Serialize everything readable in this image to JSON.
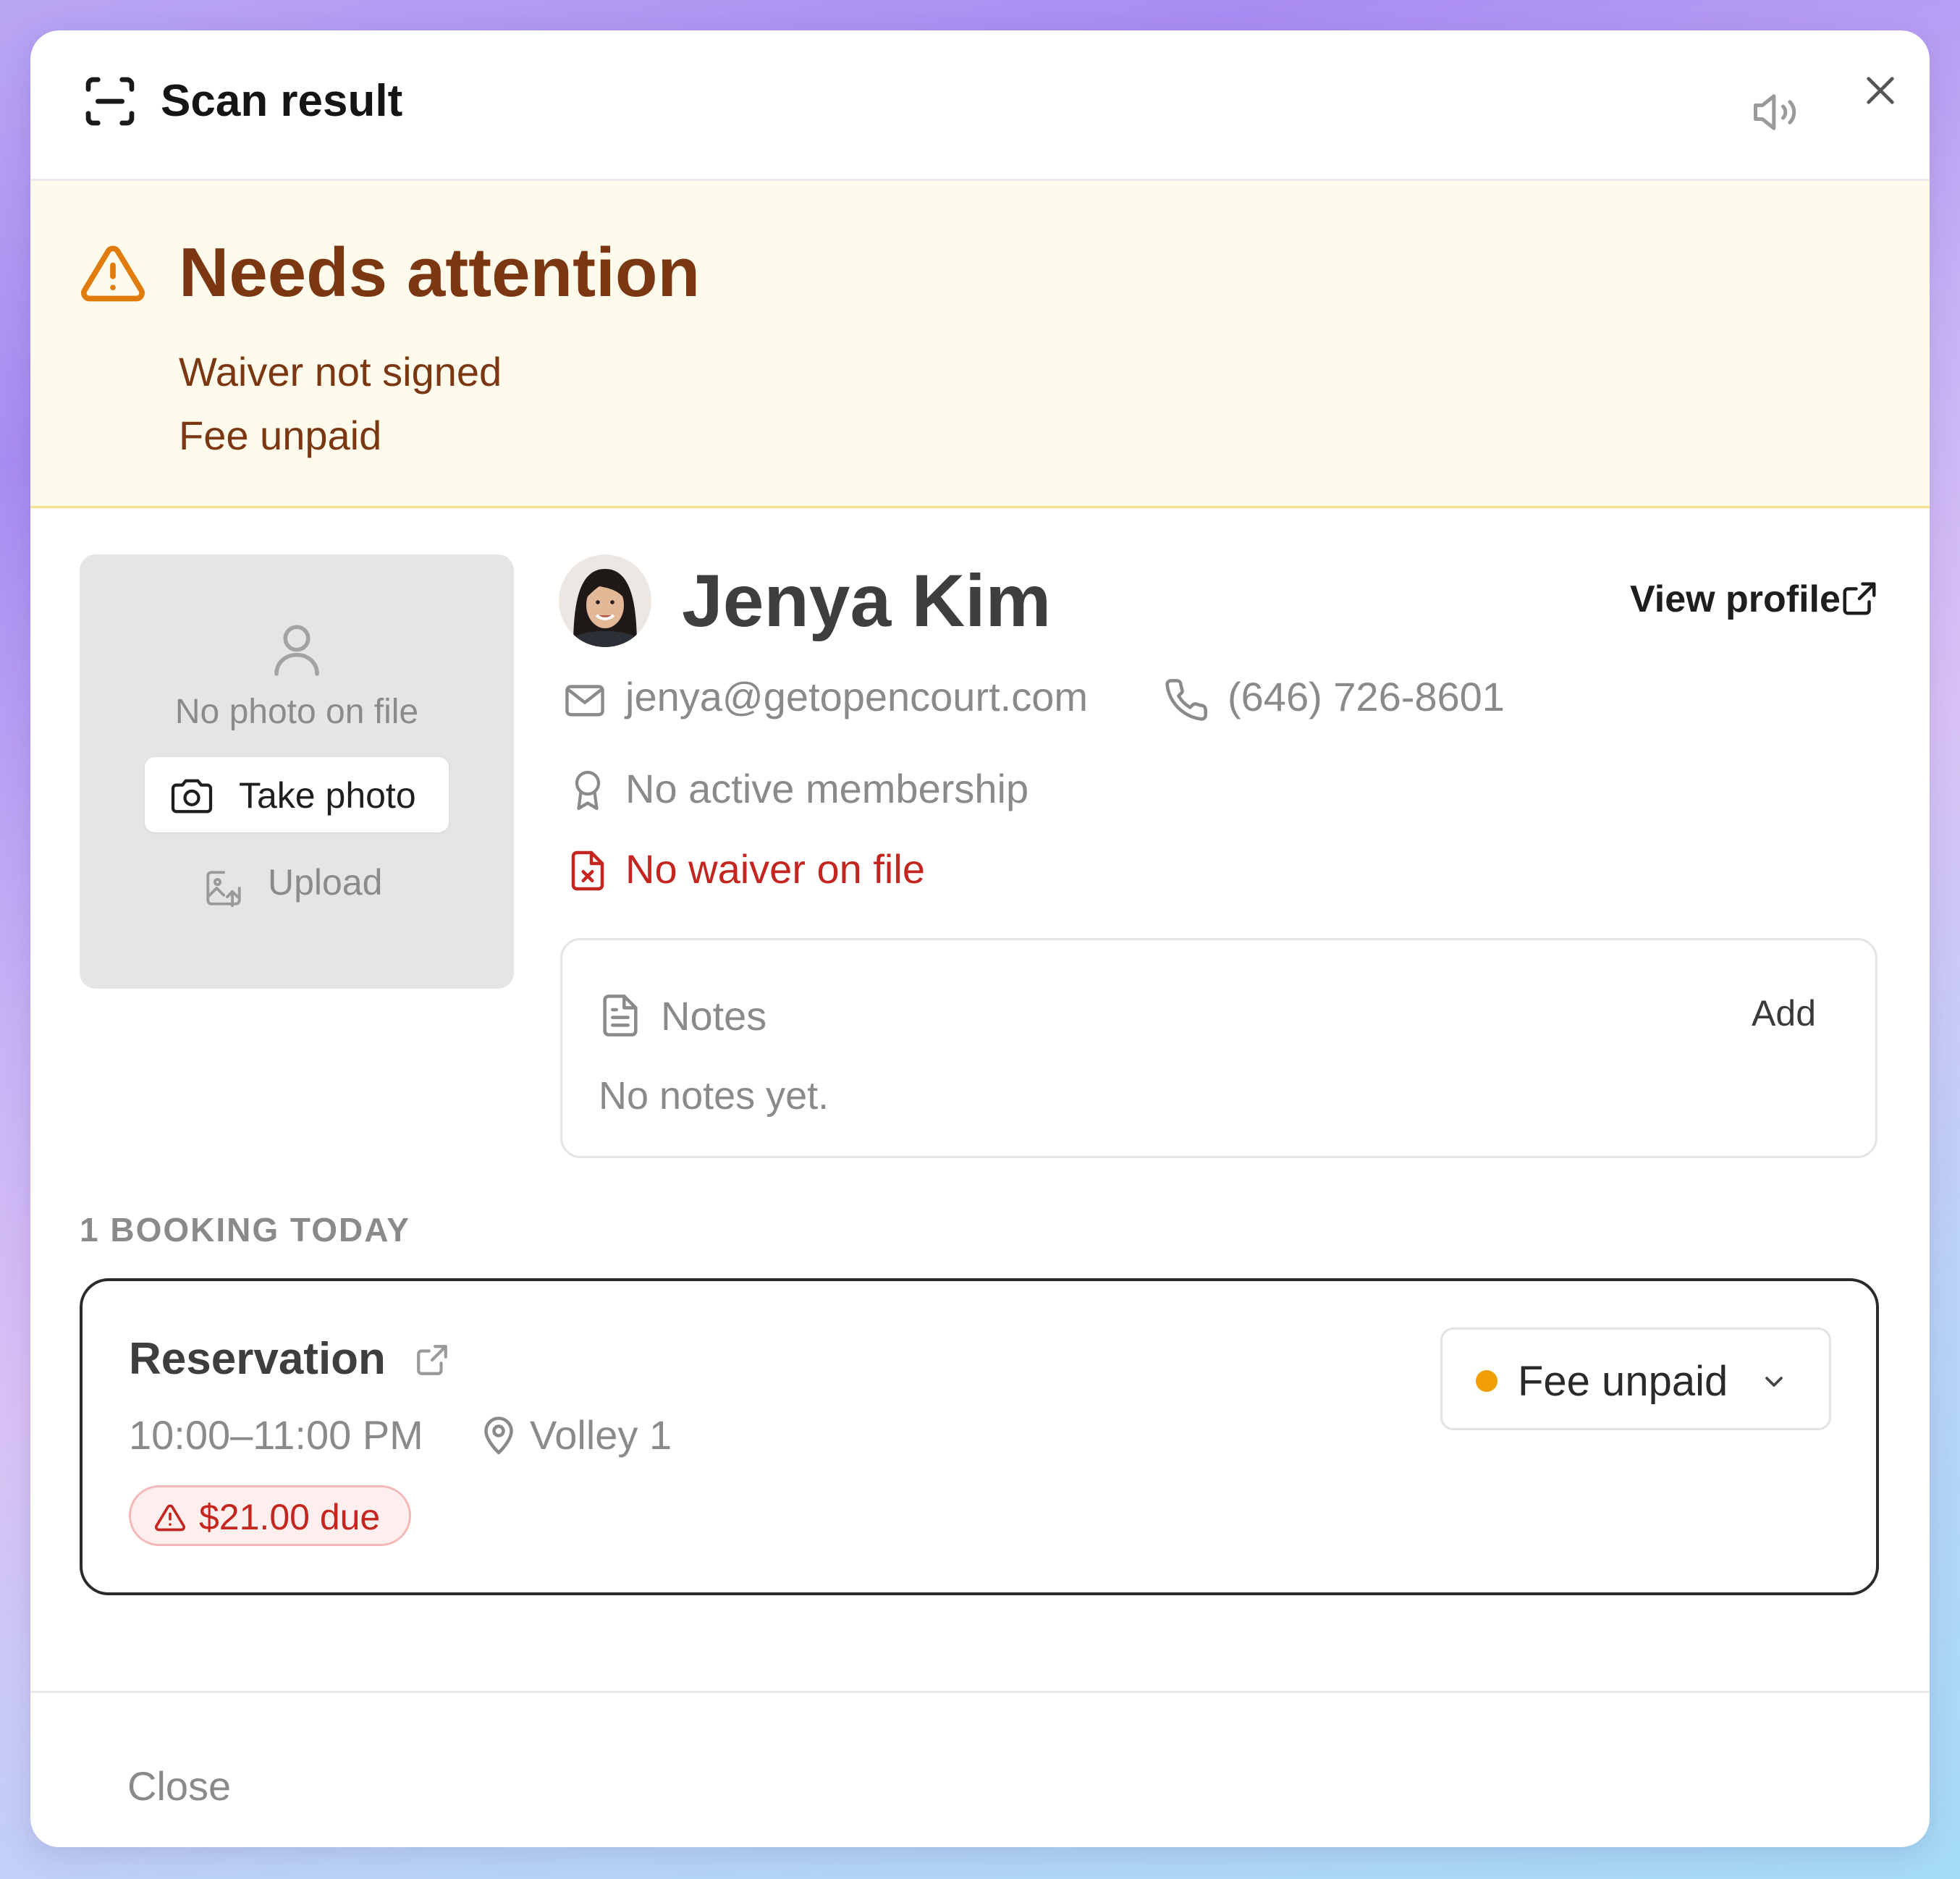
{
  "header": {
    "title": "Scan result",
    "icons": {
      "scan": "scan-frame-icon",
      "sound": "speaker-icon",
      "close": "close-icon"
    }
  },
  "alert": {
    "title": "Needs attention",
    "items": [
      "Waiver not signed",
      "Fee unpaid"
    ],
    "icon": "warning-triangle-icon",
    "color": "#7a3712",
    "background": "#fefbec"
  },
  "photo": {
    "empty_label": "No photo on file",
    "take_photo_label": "Take photo",
    "upload_label": "Upload"
  },
  "profile": {
    "name": "Jenya Kim",
    "view_profile_label": "View profile",
    "email": "jenya@getopencourt.com",
    "phone": "(646) 726-8601",
    "membership": "No active membership",
    "waiver": "No waiver on file",
    "waiver_color": "#c4251e"
  },
  "notes": {
    "title": "Notes",
    "add_label": "Add",
    "empty_text": "No notes yet."
  },
  "bookings": {
    "section_label": "1 BOOKING TODAY",
    "items": [
      {
        "title": "Reservation",
        "time": "10:00–11:00 PM",
        "court": "Volley 1",
        "due": "$21.00 due",
        "status": "Fee unpaid",
        "status_color": "#f29f05"
      }
    ]
  },
  "footer": {
    "close_label": "Close"
  }
}
